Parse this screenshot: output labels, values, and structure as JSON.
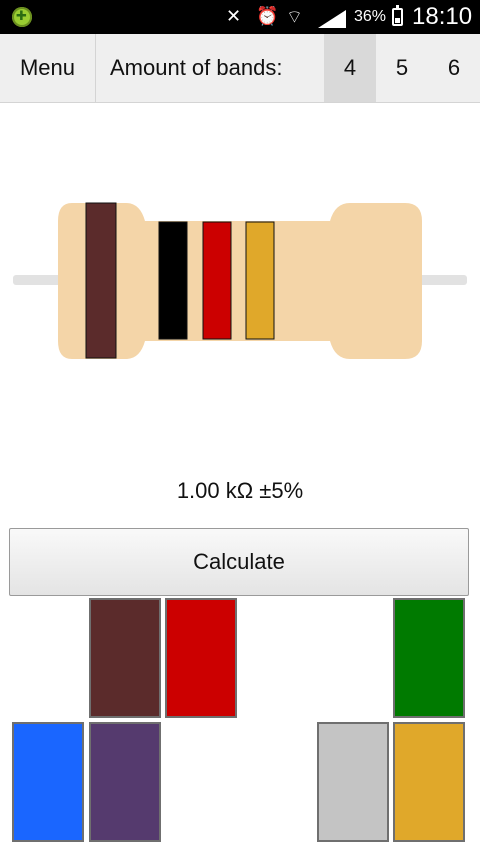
{
  "status_bar": {
    "battery_percent": "36%",
    "battery_level": 0.36,
    "time": "18:10",
    "icons": [
      "app-notification-icon",
      "mute-icon",
      "alarm-icon",
      "wifi-icon",
      "signal-icon",
      "battery-icon"
    ]
  },
  "toolbar": {
    "menu_label": "Menu",
    "bands_label": "Amount of bands:",
    "band_options": [
      "4",
      "5",
      "6"
    ],
    "selected_band": "4"
  },
  "resistor": {
    "body_color": "#f4d5a8",
    "lead_color": "#e2e2e2",
    "bands": [
      {
        "name": "brown",
        "color": "#5b2b2b"
      },
      {
        "name": "black",
        "color": "#000000"
      },
      {
        "name": "red",
        "color": "#cc0000"
      },
      {
        "name": "gold",
        "color": "#e0a82a"
      }
    ]
  },
  "result_text": "1.00 kΩ ±5%",
  "calculate_label": "Calculate",
  "palette": [
    {
      "name": "brown",
      "color": "#5b2b2b"
    },
    {
      "name": "red",
      "color": "#cc0000"
    },
    {
      "name": "green",
      "color": "#007a00"
    },
    {
      "name": "blue",
      "color": "#1a66ff"
    },
    {
      "name": "violet",
      "color": "#553a6e"
    },
    {
      "name": "grey",
      "color": "#c4c4c4"
    },
    {
      "name": "gold",
      "color": "#e0a82a"
    }
  ]
}
